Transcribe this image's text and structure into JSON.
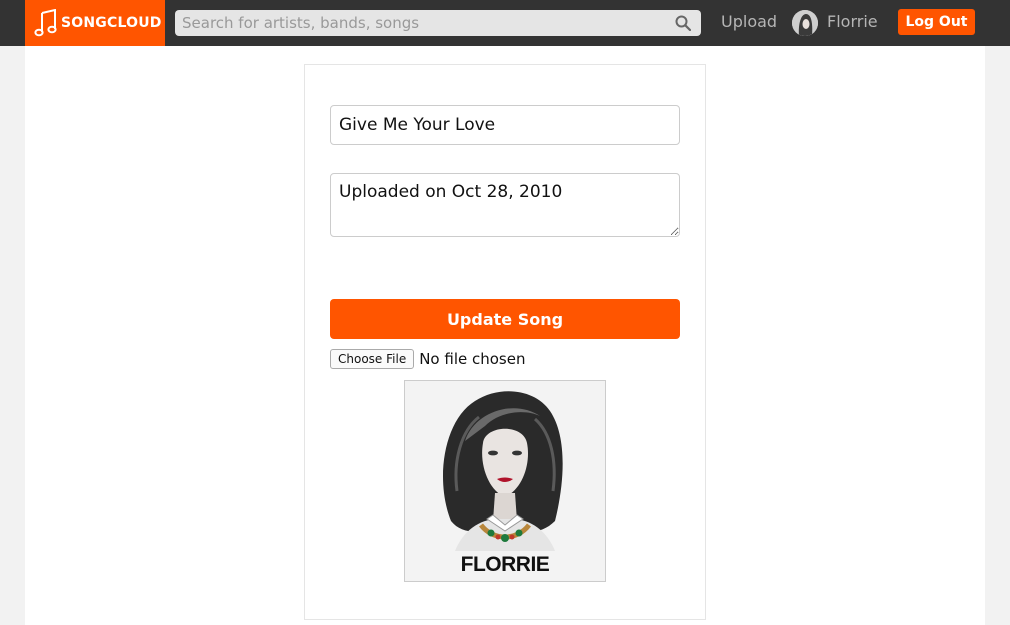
{
  "brand": {
    "name": "SONGCLOUD",
    "color": "#ff5500"
  },
  "search": {
    "placeholder": "Search for artists, bands, songs",
    "icon": "search-icon"
  },
  "nav": {
    "upload_label": "Upload",
    "user_name": "Florrie",
    "logout_label": "Log Out"
  },
  "form": {
    "title_value": "Give Me Your Love",
    "description_value": "Uploaded on Oct 28, 2010",
    "submit_label": "Update Song",
    "file_button_label": "Choose File",
    "file_status": "No file chosen"
  },
  "cover": {
    "caption": "FLORRIE"
  }
}
